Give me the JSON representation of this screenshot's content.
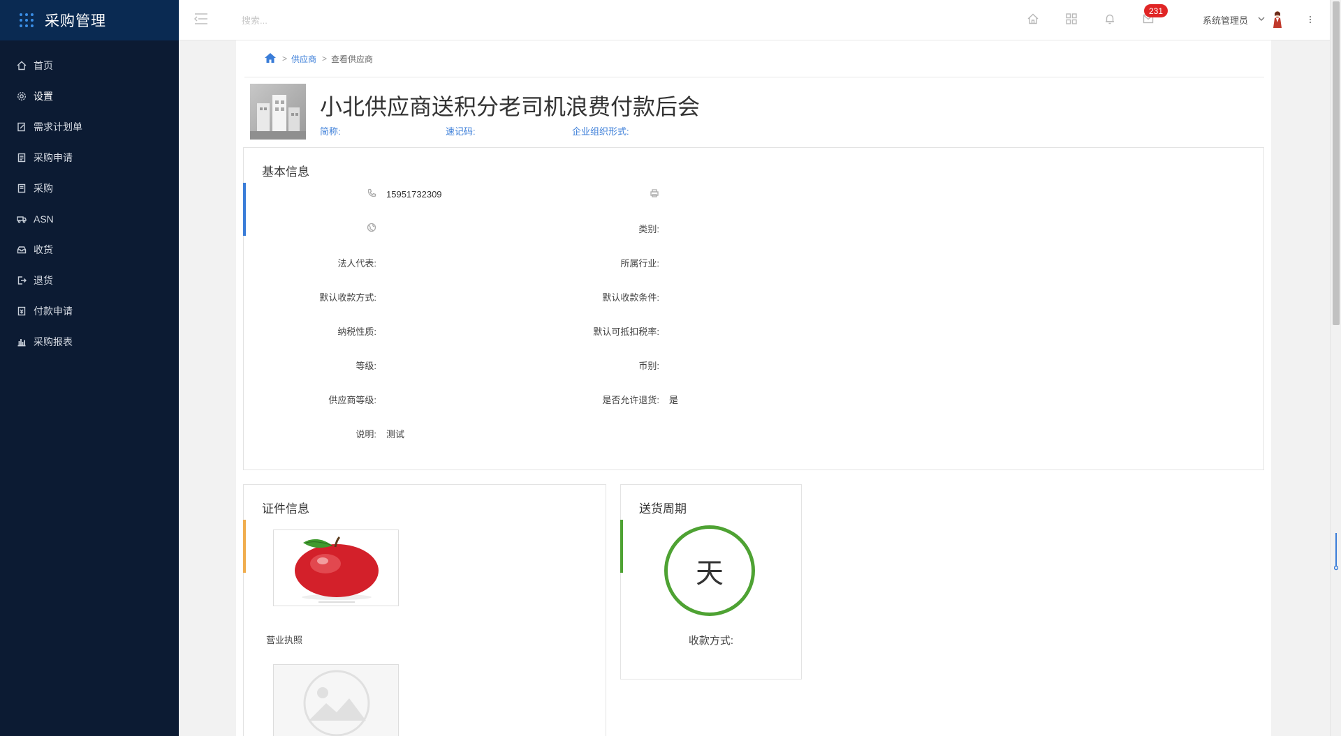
{
  "sidebar": {
    "title": "采购管理",
    "items": [
      {
        "label": "首页",
        "icon": "home-icon"
      },
      {
        "label": "设置",
        "icon": "gear-icon",
        "active": true
      },
      {
        "label": "需求计划单",
        "icon": "document-edit-icon"
      },
      {
        "label": "采购申请",
        "icon": "clipboard-icon"
      },
      {
        "label": "采购",
        "icon": "list-icon"
      },
      {
        "label": "ASN",
        "icon": "truck-icon"
      },
      {
        "label": "收货",
        "icon": "inbox-icon"
      },
      {
        "label": "退货",
        "icon": "exit-icon"
      },
      {
        "label": "付款申请",
        "icon": "payment-icon"
      },
      {
        "label": "采购报表",
        "icon": "bar-chart-icon"
      }
    ]
  },
  "header": {
    "search_placeholder": "搜索...",
    "notification_count": "231",
    "user_name": "系统管理员"
  },
  "breadcrumb": {
    "items": [
      "供应商",
      "查看供应商"
    ],
    "separator": ">"
  },
  "supplier": {
    "name": "小北供应商送积分老司机浪费付款后会",
    "short_name_label": "简称:",
    "short_code_label": "速记码:",
    "org_form_label": "企业组织形式:"
  },
  "basic_info": {
    "title": "基本信息",
    "phone": "15951732309",
    "fields": {
      "category_label": "类别:",
      "legal_rep_label": "法人代表:",
      "industry_label": "所属行业:",
      "default_receive_method_label": "默认收款方式:",
      "default_receive_terms_label": "默认收款条件:",
      "tax_nature_label": "纳税性质:",
      "default_deductible_rate_label": "默认可抵扣税率:",
      "grade_label": "等级:",
      "currency_label": "币别:",
      "supplier_grade_label": "供应商等级:",
      "allow_return_label": "是否允许退货:",
      "allow_return_value": "是",
      "description_label": "说明:",
      "description_value": "测试"
    }
  },
  "certificates": {
    "title": "证件信息",
    "caption": "营业执照"
  },
  "delivery_cycle": {
    "title": "送货周期",
    "unit": "天",
    "payment_method_label": "收款方式:"
  },
  "colors": {
    "sidebar_bg": "#0c1b33",
    "accent_blue": "#3a7dd8",
    "accent_orange": "#f0ad4e",
    "accent_green": "#4ea233",
    "badge_red": "#e02525"
  }
}
